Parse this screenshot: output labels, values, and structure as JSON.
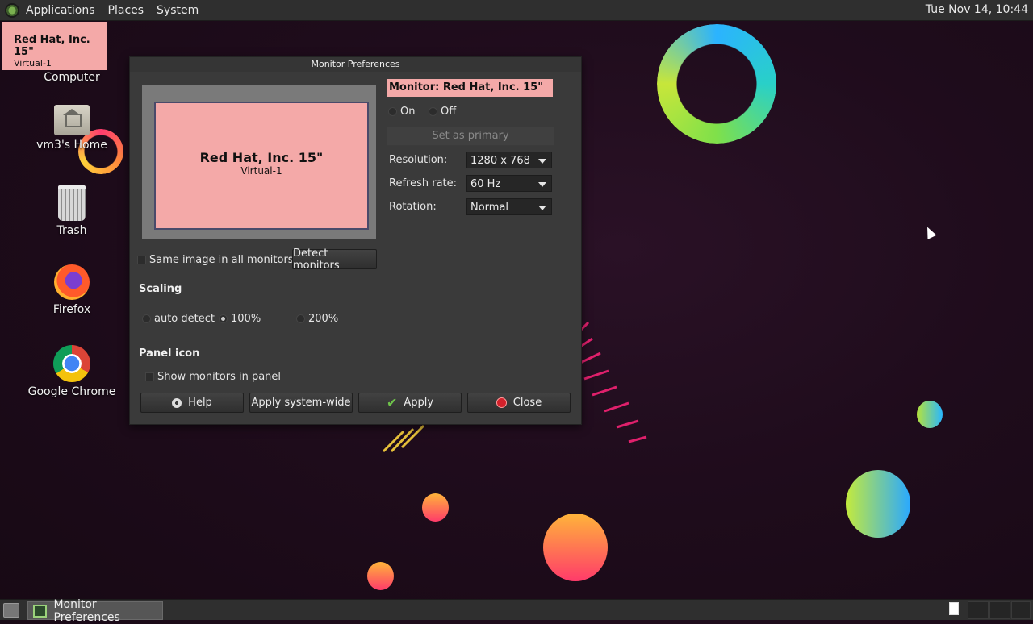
{
  "top_panel": {
    "menus": [
      "Applications",
      "Places",
      "System"
    ],
    "clock": "Tue Nov 14, 10:44"
  },
  "overlay": {
    "name": "Red Hat, Inc. 15\"",
    "sub": "Virtual-1"
  },
  "desktop_icons": [
    {
      "label": "Computer",
      "icon": "computer-icon"
    },
    {
      "label": "vm3's Home",
      "icon": "home-folder-icon"
    },
    {
      "label": "Trash",
      "icon": "trash-icon"
    },
    {
      "label": "Firefox",
      "icon": "firefox-icon"
    },
    {
      "label": "Google Chrome",
      "icon": "chrome-icon"
    }
  ],
  "dialog": {
    "title": "Monitor Preferences",
    "preview": {
      "name": "Red Hat, Inc. 15\"",
      "sub": "Virtual-1"
    },
    "monitor_header": "Monitor: Red Hat, Inc. 15\"",
    "on_label": "On",
    "off_label": "Off",
    "set_primary": "Set as primary",
    "resolution_label": "Resolution:",
    "resolution_value": "1280 x 768",
    "refresh_label": "Refresh rate:",
    "refresh_value": "60 Hz",
    "rotation_label": "Rotation:",
    "rotation_value": "Normal",
    "same_image": "Same image in all monitors",
    "detect_monitors": "Detect monitors",
    "scaling_title": "Scaling",
    "scaling_options": [
      "auto detect",
      "100%",
      "200%"
    ],
    "panel_icon_title": "Panel icon",
    "show_monitors": "Show monitors in panel",
    "buttons": {
      "help": "Help",
      "apply_system": "Apply system-wide",
      "apply": "Apply",
      "close": "Close"
    }
  },
  "taskbar": {
    "task": "Monitor Preferences"
  },
  "colors": {
    "accent_pink": "#f4a9a8",
    "panel": "#2f2f2f",
    "dialog_bg": "#3a3a3a"
  }
}
